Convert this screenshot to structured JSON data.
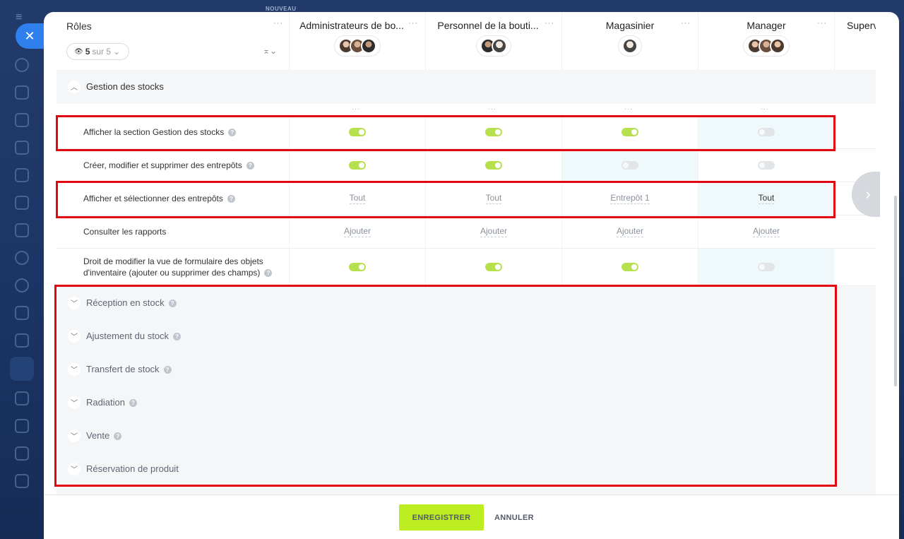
{
  "badge_new": "NOUVEAU",
  "rail": {
    "close_icon": "close-icon",
    "menu_icon": "hamburger-icon"
  },
  "header": {
    "roles_title": "Rôles",
    "roles_count": "5",
    "roles_total": "sur 5",
    "columns": [
      {
        "name": "Administrateurs de bo...",
        "avatars": 3
      },
      {
        "name": "Personnel de la bouti...",
        "avatars": 2
      },
      {
        "name": "Magasinier",
        "avatars": 1
      },
      {
        "name": "Manager",
        "avatars": 3
      },
      {
        "name": "Superv"
      }
    ]
  },
  "sections": {
    "open": {
      "title": "Gestion des stocks"
    },
    "collapsed": [
      "Réception en stock",
      "Ajustement du stock",
      "Transfert de stock",
      "Radiation",
      "Vente",
      "Réservation de produit"
    ]
  },
  "rows": [
    {
      "label": "Afficher la section Gestion des stocks",
      "cells": [
        "on",
        "on",
        "on",
        "off"
      ]
    },
    {
      "label": "Créer, modifier et supprimer des entrepôts",
      "cells": [
        "on",
        "on",
        "off",
        "off"
      ]
    },
    {
      "label": "Afficher et sélectionner des entrepôts",
      "cells": [
        "Tout",
        "Tout",
        "Entrepôt 1",
        "Tout"
      ]
    },
    {
      "label": "Consulter les rapports",
      "cells": [
        "Ajouter",
        "Ajouter",
        "Ajouter",
        "Ajouter"
      ]
    },
    {
      "label": "Droit de modifier la vue de formulaire des objets d'inventaire (ajouter ou supprimer des champs)",
      "cells": [
        "on",
        "on",
        "on",
        "off"
      ]
    }
  ],
  "footer": {
    "save": "ENREGISTRER",
    "cancel": "ANNULER"
  },
  "colors": {
    "accent": "#2f80ed",
    "toggle_on": "#b7e04e",
    "save_button": "#bbed21",
    "highlight_box": "#e1060f"
  }
}
